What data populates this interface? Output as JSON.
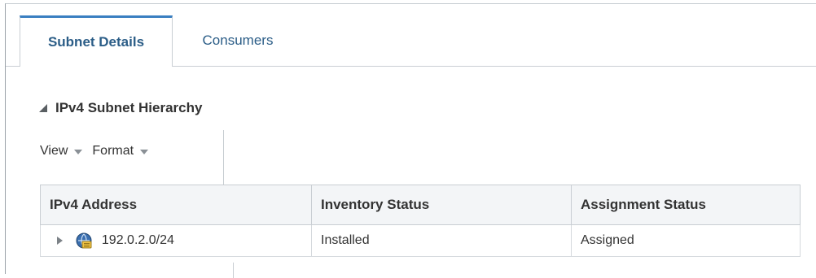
{
  "tabs": [
    {
      "label": "Subnet Details",
      "active": true
    },
    {
      "label": "Consumers",
      "active": false
    }
  ],
  "section": {
    "title": "IPv4 Subnet Hierarchy"
  },
  "toolbar": {
    "view_label": "View",
    "format_label": "Format"
  },
  "table": {
    "columns": [
      "IPv4 Address",
      "Inventory Status",
      "Assignment Status"
    ],
    "rows": [
      {
        "address": "192.0.2.0/24",
        "inventory_status": "Installed",
        "assignment_status": "Assigned",
        "icon": "ip-subnet-icon"
      }
    ]
  },
  "colors": {
    "accent": "#3a7fc1",
    "link": "#2b5d87",
    "header_bg": "#f3f5f7"
  }
}
